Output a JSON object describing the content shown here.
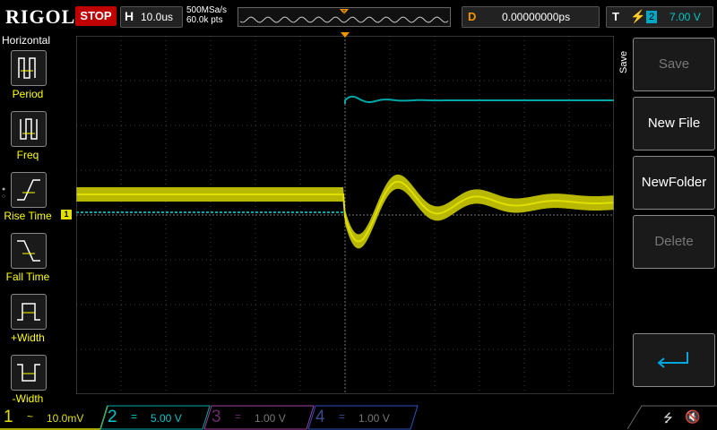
{
  "header": {
    "brand": "RIGOL",
    "run_state": "STOP",
    "horizontal_label": "H",
    "timebase": "10.0us",
    "sample_rate": "500MSa/s",
    "memory_depth": "60.0k pts",
    "delay_label": "D",
    "delay_value": "0.00000000ps",
    "trigger_label": "T",
    "trigger_channel": "2",
    "trigger_level": "7.00 V"
  },
  "left_menu": {
    "title": "Horizontal",
    "items": [
      {
        "label": "Period"
      },
      {
        "label": "Freq"
      },
      {
        "label": "Rise Time"
      },
      {
        "label": "Fall Time"
      },
      {
        "label": "+Width"
      },
      {
        "label": "-Width"
      }
    ]
  },
  "right_menu": {
    "title": "Save",
    "buttons": [
      {
        "label": "Save",
        "enabled": false
      },
      {
        "label": "New File",
        "enabled": true
      },
      {
        "label": "NewFolder",
        "enabled": true
      },
      {
        "label": "Delete",
        "enabled": false
      },
      {
        "label": "",
        "enabled": true
      }
    ]
  },
  "channels": [
    {
      "num": "1",
      "coupling": "~",
      "scale": "10.0mV",
      "color": "#e0e000",
      "active": true
    },
    {
      "num": "2",
      "coupling": "=",
      "scale": "5.00 V",
      "color": "#00c8c8",
      "active": true
    },
    {
      "num": "3",
      "coupling": "=",
      "scale": "1.00 V",
      "color": "#c040c0",
      "active": false
    },
    {
      "num": "4",
      "coupling": "=",
      "scale": "1.00 V",
      "color": "#4060e0",
      "active": false
    }
  ],
  "markers": {
    "ch1_marker": "1",
    "trigger_marker": "T"
  },
  "colors": {
    "ch1": "#e0e000",
    "ch2": "#00a7a7",
    "grid": "#4a4a4a",
    "accent": "#f29600"
  }
}
